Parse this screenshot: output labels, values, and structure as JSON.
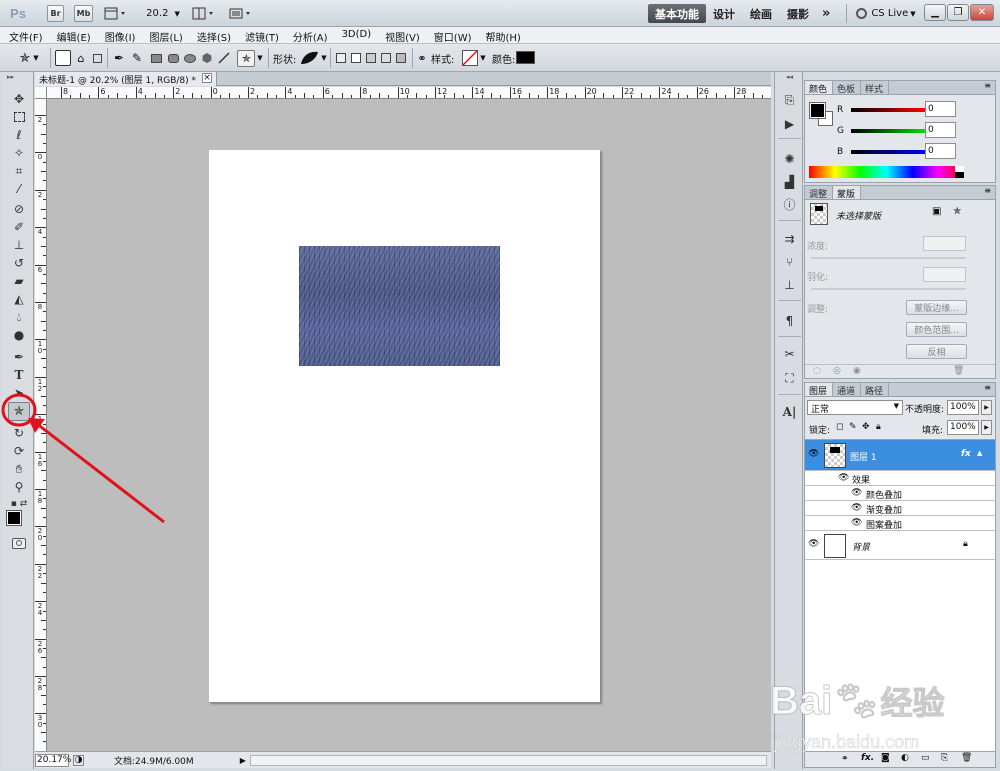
{
  "app": {
    "logo": "Ps",
    "br_label": "Br",
    "mb_label": "Mb",
    "zoom_value": "20.2",
    "workspaces": [
      "基本功能",
      "设计",
      "绘画",
      "摄影"
    ],
    "more": "»",
    "cslive": "CS Live"
  },
  "menu": [
    "文件(F)",
    "编辑(E)",
    "图像(I)",
    "图层(L)",
    "选择(S)",
    "滤镜(T)",
    "分析(A)",
    "3D(D)",
    "视图(V)",
    "窗口(W)",
    "帮助(H)"
  ],
  "options": {
    "shape_label": "形状:",
    "style_label": "样式:",
    "color_label": "颜色:",
    "color_value": "#000000"
  },
  "document": {
    "tab_title": "未标题-1 @ 20.2% (图层 1, RGB/8) *",
    "close": "×",
    "ruler_top_labels": [
      "8",
      "6",
      "4",
      "2",
      "0",
      "2",
      "4",
      "6",
      "8",
      "10",
      "12",
      "14",
      "16",
      "18",
      "20",
      "22",
      "24",
      "26",
      "28"
    ],
    "ruler_left_labels": [
      "2",
      "0",
      "2",
      "4",
      "6",
      "8",
      "1 0",
      "1 2",
      "1 4",
      "1 6",
      "1 8",
      "2 0",
      "2 2",
      "2 4",
      "2 6",
      "2 8",
      "3 0"
    ],
    "zoom_field": "20.17%",
    "doc_info": "文档:24.9M/6.00M"
  },
  "color_panel": {
    "tabs": [
      "颜色",
      "色板",
      "样式"
    ],
    "channels": [
      {
        "label": "R",
        "value": "0"
      },
      {
        "label": "G",
        "value": "0"
      },
      {
        "label": "B",
        "value": "0"
      }
    ]
  },
  "adjust_panel": {
    "tabs": [
      "调整",
      "蒙版"
    ],
    "mask_title": "未选择蒙版",
    "density_label": "浓度:",
    "feather_label": "羽化:",
    "refine_label": "调整:",
    "buttons": [
      "蒙版边缘...",
      "颜色范围...",
      "反相"
    ]
  },
  "layers_panel": {
    "tabs": [
      "图层",
      "通道",
      "路径"
    ],
    "blend_mode": "正常",
    "opacity_label": "不透明度:",
    "opacity_value": "100%",
    "lock_label": "锁定:",
    "fill_label": "填充:",
    "fill_value": "100%",
    "layer1_name": "图层 1",
    "fx": "fx",
    "effects_label": "效果",
    "effects": [
      "颜色叠加",
      "渐变叠加",
      "图案叠加"
    ],
    "background_name": "背景"
  },
  "annotation_color": "#e0121b",
  "watermark": {
    "brand": "Bai",
    "brand_cn": "经验",
    "site": "jingyan.baidu.com"
  }
}
